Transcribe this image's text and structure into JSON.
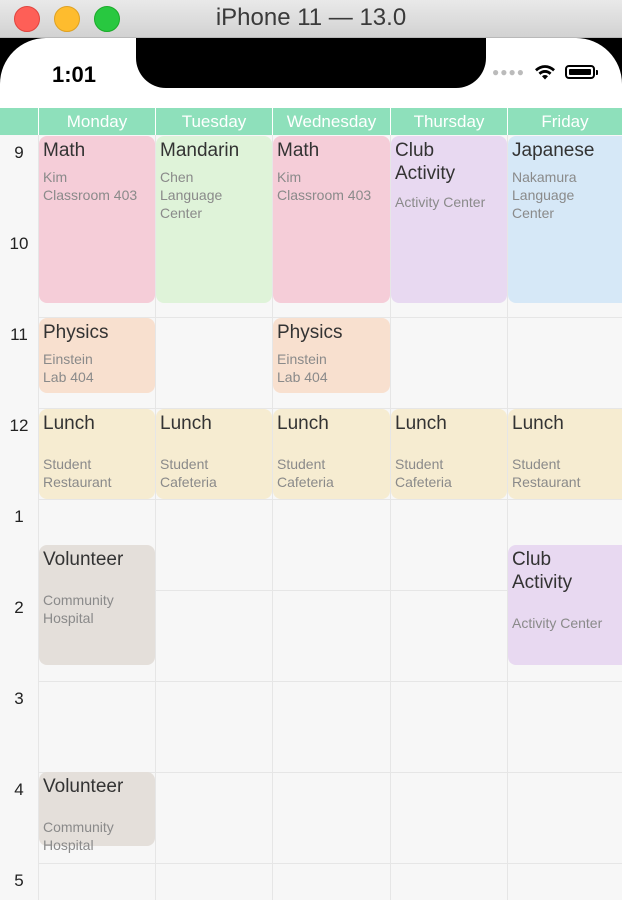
{
  "window": {
    "title": "iPhone 11 — 13.0"
  },
  "status_bar": {
    "time": "1:01"
  },
  "days": [
    "Monday",
    "Tuesday",
    "Wednesday",
    "Thursday",
    "Friday"
  ],
  "hours": [
    "9",
    "10",
    "11",
    "12",
    "1",
    "2",
    "3",
    "4",
    "5"
  ],
  "courses": {
    "mon_math": {
      "name": "Math",
      "teacher": "Kim",
      "room": "Classroom 403",
      "color": "#f5cdd8"
    },
    "tue_mandarin": {
      "name": "Mandarin",
      "teacher": "Chen",
      "room1": "Language",
      "room2": "Center",
      "color": "#dff3d9"
    },
    "wed_math": {
      "name": "Math",
      "teacher": "Kim",
      "room": "Classroom 403",
      "color": "#f5cdd8"
    },
    "thu_club": {
      "name1": "Club",
      "name2": "Activity",
      "room": "Activity Center",
      "color": "#e8d9f1"
    },
    "fri_japanese": {
      "name": "Japanese",
      "teacher": "Nakamura",
      "room1": "Language",
      "room2": "Center",
      "color": "#d6e8f7"
    },
    "mon_physics": {
      "name": "Physics",
      "teacher": "Einstein",
      "room": "Lab 404",
      "color": "#f8e0cf"
    },
    "wed_physics": {
      "name": "Physics",
      "teacher": "Einstein",
      "room": "Lab 404",
      "color": "#f8e0cf"
    },
    "mon_lunch": {
      "name": "Lunch",
      "room1": "Student",
      "room2": "Restaurant",
      "color": "#f6ecd1"
    },
    "tue_lunch": {
      "name": "Lunch",
      "room1": "Student",
      "room2": "Cafeteria",
      "color": "#f6ecd1"
    },
    "wed_lunch": {
      "name": "Lunch",
      "room1": "Student",
      "room2": "Cafeteria",
      "color": "#f6ecd1"
    },
    "thu_lunch": {
      "name": "Lunch",
      "room1": "Student",
      "room2": "Cafeteria",
      "color": "#f6ecd1"
    },
    "fri_lunch": {
      "name": "Lunch",
      "room1": "Student",
      "room2": "Restaurant",
      "color": "#f6ecd1"
    },
    "mon_volunteer1": {
      "name": "Volunteer",
      "room1": "Community",
      "room2": "Hospital",
      "color": "#e4dfda"
    },
    "fri_club": {
      "name1": "Club",
      "name2": "Activity",
      "room": "Activity Center",
      "color": "#e8d9f1"
    },
    "mon_volunteer2": {
      "name": "Volunteer",
      "room1": "Community",
      "room2": "Hospital",
      "color": "#e4dfda"
    }
  },
  "colors": {
    "header_bg": "#8ee0bb",
    "grid_line": "#e6e6e6"
  }
}
